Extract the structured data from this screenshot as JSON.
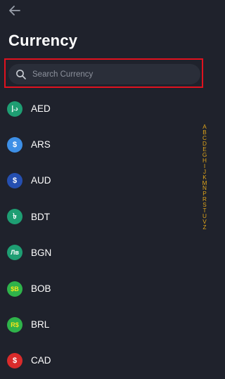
{
  "header": {
    "title": "Currency"
  },
  "search": {
    "placeholder": "Search Currency"
  },
  "currencies": [
    {
      "code": "AED",
      "symbol": "د.إ",
      "color": "#1e9e73"
    },
    {
      "code": "ARS",
      "symbol": "$",
      "color": "#3d8fe6"
    },
    {
      "code": "AUD",
      "symbol": "$",
      "color": "#254fb0"
    },
    {
      "code": "BDT",
      "symbol": "৳",
      "color": "#1e9e73"
    },
    {
      "code": "BGN",
      "symbol": "Лв",
      "color": "#1e9e73"
    },
    {
      "code": "BOB",
      "symbol": "$B",
      "color": "#2fb34a"
    },
    {
      "code": "BRL",
      "symbol": "R$",
      "color": "#2fb34a"
    },
    {
      "code": "CAD",
      "symbol": "$",
      "color": "#d92b2b"
    }
  ],
  "index": [
    "A",
    "B",
    "C",
    "D",
    "E",
    "G",
    "H",
    "I",
    "J",
    "K",
    "M",
    "N",
    "P",
    "R",
    "S",
    "T",
    "U",
    "V",
    "Z"
  ],
  "colors": {
    "background": "#1f222c",
    "accent": "#e0a51a",
    "highlight": "#e0121f"
  }
}
